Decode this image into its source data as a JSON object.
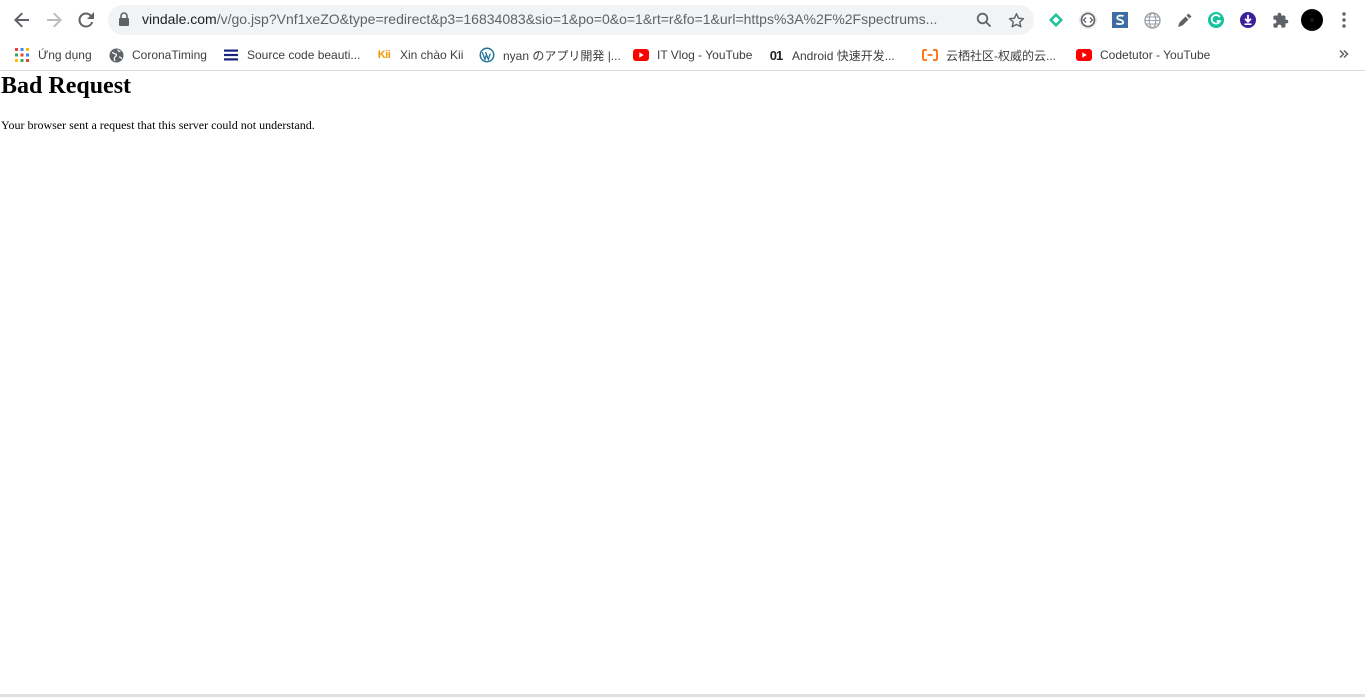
{
  "address_bar": {
    "url_domain": "vindale.com",
    "url_rest": "/v/go.jsp?Vnf1xeZO&type=redirect&p3=16834083&sio=1&po=0&o=1&rt=r&fo=1&url=https%3A%2F%2Fspectrums..."
  },
  "bookmarks": [
    {
      "label": "Ứng dụng",
      "icon": "apps-grid-icon"
    },
    {
      "label": "CoronaTiming",
      "icon": "globe-icon"
    },
    {
      "label": "Source code beauti...",
      "icon": "menu-lines-icon"
    },
    {
      "label": "Xin chào Kii",
      "icon": "kii-logo-icon"
    },
    {
      "label": "nyan のアプリ開発 |...",
      "icon": "wordpress-icon"
    },
    {
      "label": "IT Vlog - YouTube",
      "icon": "youtube-icon"
    },
    {
      "label": "Android 快速开发...",
      "icon": "01-logo-icon"
    },
    {
      "label": "云栖社区-权威的云...",
      "icon": "aliyun-icon"
    },
    {
      "label": "Codetutor - YouTube",
      "icon": "youtube-icon"
    }
  ],
  "page": {
    "title": "Bad Request",
    "message": "Your browser sent a request that this server could not understand."
  },
  "colors": {
    "accent_youtube": "#ff0000",
    "accent_kii": "#f29900",
    "accent_aliyun": "#ff6a00"
  }
}
